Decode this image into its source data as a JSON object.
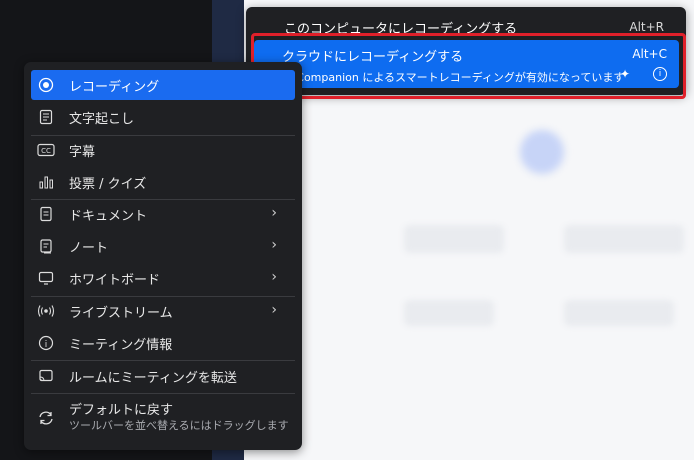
{
  "recording_menu": {
    "items": [
      {
        "label": "このコンピュータにレコーディングする",
        "shortcut": "Alt+R"
      },
      {
        "label": "クラウドにレコーディングする",
        "shortcut": "Alt+C"
      }
    ],
    "ai_note": "AI Companion によるスマートレコーディングが有効になっています",
    "accent": "#0e6cf0",
    "highlight_color": "#e0202a"
  },
  "toolbar_menu": {
    "items": [
      {
        "label": "レコーディング",
        "icon": "record-icon",
        "active": true
      },
      {
        "label": "文字起こし",
        "icon": "transcript-icon"
      },
      {
        "label": "字幕",
        "icon": "cc-icon"
      },
      {
        "label": "投票 / クイズ",
        "icon": "poll-icon"
      },
      {
        "label": "ドキュメント",
        "icon": "document-icon",
        "submenu": true
      },
      {
        "label": "ノート",
        "icon": "notes-icon",
        "submenu": true
      },
      {
        "label": "ホワイトボード",
        "icon": "whiteboard-icon",
        "submenu": true
      },
      {
        "label": "ライブストリーム",
        "icon": "livestream-icon",
        "submenu": true
      },
      {
        "label": "ミーティング情報",
        "icon": "info-icon"
      },
      {
        "label": "ルームにミーティングを転送",
        "icon": "cast-icon"
      }
    ],
    "reset": {
      "label": "デフォルトに戻す",
      "sub": "ツールバーを並べ替えるにはドラッグします"
    },
    "arrow": "›"
  }
}
